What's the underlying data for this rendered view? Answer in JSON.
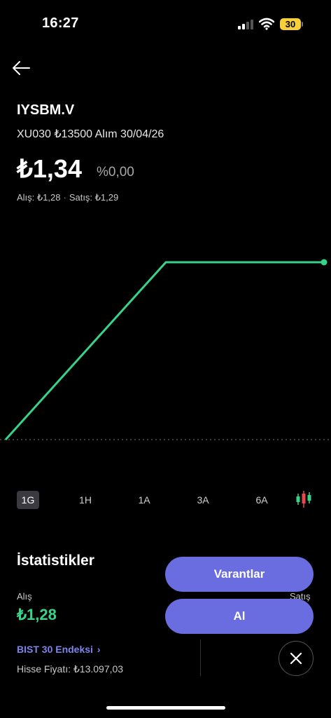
{
  "status_bar": {
    "time": "16:27",
    "battery": "30"
  },
  "header": {
    "symbol": "IYSBM.V",
    "description": "XU030 ₺13500 Alım 30/04/26",
    "price": "₺1,34",
    "change": "%0,00",
    "bid_text": "Alış: ₺1,28",
    "ask_text": "Satış: ₺1,29"
  },
  "chart_data": {
    "type": "line",
    "title": "",
    "xlabel": "",
    "ylabel": "",
    "x": [
      0,
      1,
      2
    ],
    "values": [
      1.28,
      1.34,
      1.34
    ],
    "baseline": 1.28,
    "line_color": "#37d38a",
    "grid": false
  },
  "ranges": [
    "1G",
    "1H",
    "1A",
    "3A",
    "6A"
  ],
  "active_range": "1G",
  "stats": {
    "title": "İstatistikler",
    "bid_label": "Alış",
    "bid_value": "₺1,28",
    "ask_label": "Satış",
    "index_link": "BIST 30 Endeksi",
    "share_price": "Hisse Fiyatı: ₺13.097,03"
  },
  "actions": {
    "warrants_label": "Varantlar",
    "buy_label": "Al"
  },
  "colors": {
    "accent": "#6a6de0",
    "positive": "#37d38a"
  }
}
